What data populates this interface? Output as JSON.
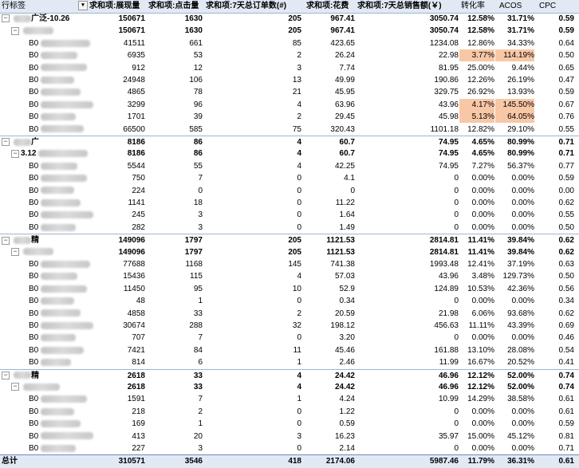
{
  "header": {
    "row_label": "行标签",
    "columns": [
      "求和项:展现量",
      "求和项:点击量",
      "求和项:7天总订单数(#)",
      "求和项:花费",
      "求和项:7天总销售额(￥)",
      "转化率",
      "ACOS",
      "CPC"
    ],
    "filter_icon": "filter-dropdown-icon",
    "expand_icon": "collapse-minus-icon"
  },
  "rows": [
    {
      "label": "广泛-10.26",
      "blurred": true,
      "level": 0,
      "expander": true,
      "bold": true,
      "values": [
        "150671",
        "1630",
        "205",
        "967.41",
        "3050.74",
        "12.58%",
        "31.71%",
        "0.59"
      ],
      "hl": []
    },
    {
      "label": "",
      "blurred": true,
      "level": 1,
      "expander": true,
      "bold": true,
      "values": [
        "150671",
        "1630",
        "205",
        "967.41",
        "3050.74",
        "12.58%",
        "31.71%",
        "0.59"
      ],
      "hl": []
    },
    {
      "label": "B0",
      "blurred": true,
      "level": 2,
      "bold": false,
      "values": [
        "41511",
        "661",
        "85",
        "423.65",
        "1234.08",
        "12.86%",
        "34.33%",
        "0.64"
      ],
      "hl": []
    },
    {
      "label": "B0",
      "blurred": true,
      "level": 2,
      "bold": false,
      "values": [
        "6935",
        "53",
        "2",
        "26.24",
        "22.98",
        "3.77%",
        "114.19%",
        "0.50"
      ],
      "hl": [
        5,
        6
      ]
    },
    {
      "label": "B0",
      "blurred": true,
      "level": 2,
      "bold": false,
      "values": [
        "912",
        "12",
        "3",
        "7.74",
        "81.95",
        "25.00%",
        "9.44%",
        "0.65"
      ],
      "hl": []
    },
    {
      "label": "B0",
      "blurred": true,
      "level": 2,
      "bold": false,
      "values": [
        "24948",
        "106",
        "13",
        "49.99",
        "190.86",
        "12.26%",
        "26.19%",
        "0.47"
      ],
      "hl": []
    },
    {
      "label": "B0",
      "blurred": true,
      "level": 2,
      "bold": false,
      "values": [
        "4865",
        "78",
        "21",
        "45.95",
        "329.75",
        "26.92%",
        "13.93%",
        "0.59"
      ],
      "hl": []
    },
    {
      "label": "B0",
      "blurred": true,
      "level": 2,
      "bold": false,
      "values": [
        "3299",
        "96",
        "4",
        "63.96",
        "43.96",
        "4.17%",
        "145.50%",
        "0.67"
      ],
      "hl": [
        5,
        6
      ]
    },
    {
      "label": "B0",
      "blurred": true,
      "level": 2,
      "bold": false,
      "values": [
        "1701",
        "39",
        "2",
        "29.45",
        "45.98",
        "5.13%",
        "64.05%",
        "0.76"
      ],
      "hl": [
        5,
        6
      ]
    },
    {
      "label": "B0",
      "blurred": true,
      "level": 2,
      "bold": false,
      "values": [
        "66500",
        "585",
        "75",
        "320.43",
        "1101.18",
        "12.82%",
        "29.10%",
        "0.55"
      ],
      "hl": []
    },
    {
      "label": "广",
      "blurred": true,
      "level": 0,
      "expander": true,
      "bold": true,
      "group": true,
      "values": [
        "8186",
        "86",
        "4",
        "60.7",
        "74.95",
        "4.65%",
        "80.99%",
        "0.71"
      ],
      "hl": []
    },
    {
      "label": "3.12",
      "blurred": true,
      "level": 1,
      "expander": true,
      "bold": true,
      "values": [
        "8186",
        "86",
        "4",
        "60.7",
        "74.95",
        "4.65%",
        "80.99%",
        "0.71"
      ],
      "hl": []
    },
    {
      "label": "B0",
      "blurred": true,
      "level": 2,
      "bold": false,
      "values": [
        "5544",
        "55",
        "4",
        "42.25",
        "74.95",
        "7.27%",
        "56.37%",
        "0.77"
      ],
      "hl": []
    },
    {
      "label": "B0",
      "blurred": true,
      "level": 2,
      "bold": false,
      "values": [
        "750",
        "7",
        "0",
        "4.1",
        "0",
        "0.00%",
        "0.00%",
        "0.59"
      ],
      "hl": []
    },
    {
      "label": "B0",
      "blurred": true,
      "level": 2,
      "bold": false,
      "values": [
        "224",
        "0",
        "0",
        "0",
        "0",
        "0.00%",
        "0.00%",
        "0.00"
      ],
      "hl": []
    },
    {
      "label": "B0",
      "blurred": true,
      "level": 2,
      "bold": false,
      "values": [
        "1141",
        "18",
        "0",
        "11.22",
        "0",
        "0.00%",
        "0.00%",
        "0.62"
      ],
      "hl": []
    },
    {
      "label": "B0",
      "blurred": true,
      "level": 2,
      "bold": false,
      "values": [
        "245",
        "3",
        "0",
        "1.64",
        "0",
        "0.00%",
        "0.00%",
        "0.55"
      ],
      "hl": []
    },
    {
      "label": "B0",
      "blurred": true,
      "level": 2,
      "bold": false,
      "values": [
        "282",
        "3",
        "0",
        "1.49",
        "0",
        "0.00%",
        "0.00%",
        "0.50"
      ],
      "hl": []
    },
    {
      "label": "精",
      "blurred": true,
      "level": 0,
      "expander": true,
      "bold": true,
      "group": true,
      "values": [
        "149096",
        "1797",
        "205",
        "1121.53",
        "2814.81",
        "11.41%",
        "39.84%",
        "0.62"
      ],
      "hl": []
    },
    {
      "label": "",
      "blurred": true,
      "level": 1,
      "expander": true,
      "bold": true,
      "values": [
        "149096",
        "1797",
        "205",
        "1121.53",
        "2814.81",
        "11.41%",
        "39.84%",
        "0.62"
      ],
      "hl": []
    },
    {
      "label": "B0",
      "blurred": true,
      "level": 2,
      "bold": false,
      "values": [
        "77688",
        "1168",
        "145",
        "741.38",
        "1993.48",
        "12.41%",
        "37.19%",
        "0.63"
      ],
      "hl": []
    },
    {
      "label": "B0",
      "blurred": true,
      "level": 2,
      "bold": false,
      "values": [
        "15436",
        "115",
        "4",
        "57.03",
        "43.96",
        "3.48%",
        "129.73%",
        "0.50"
      ],
      "hl": []
    },
    {
      "label": "B0",
      "blurred": true,
      "level": 2,
      "bold": false,
      "values": [
        "11450",
        "95",
        "10",
        "52.9",
        "124.89",
        "10.53%",
        "42.36%",
        "0.56"
      ],
      "hl": []
    },
    {
      "label": "B0",
      "blurred": true,
      "level": 2,
      "bold": false,
      "values": [
        "48",
        "1",
        "0",
        "0.34",
        "0",
        "0.00%",
        "0.00%",
        "0.34"
      ],
      "hl": []
    },
    {
      "label": "B0",
      "blurred": true,
      "level": 2,
      "bold": false,
      "values": [
        "4858",
        "33",
        "2",
        "20.59",
        "21.98",
        "6.06%",
        "93.68%",
        "0.62"
      ],
      "hl": []
    },
    {
      "label": "B0",
      "blurred": true,
      "level": 2,
      "bold": false,
      "values": [
        "30674",
        "288",
        "32",
        "198.12",
        "456.63",
        "11.11%",
        "43.39%",
        "0.69"
      ],
      "hl": []
    },
    {
      "label": "B0",
      "blurred": true,
      "level": 2,
      "bold": false,
      "values": [
        "707",
        "7",
        "0",
        "3.20",
        "0",
        "0.00%",
        "0.00%",
        "0.46"
      ],
      "hl": []
    },
    {
      "label": "B0",
      "blurred": true,
      "level": 2,
      "bold": false,
      "values": [
        "7421",
        "84",
        "11",
        "45.46",
        "161.88",
        "13.10%",
        "28.08%",
        "0.54"
      ],
      "hl": []
    },
    {
      "label": "B0",
      "blurred": true,
      "level": 2,
      "bold": false,
      "values": [
        "814",
        "6",
        "1",
        "2.46",
        "11.99",
        "16.67%",
        "20.52%",
        "0.41"
      ],
      "hl": []
    },
    {
      "label": "精",
      "blurred": true,
      "level": 0,
      "expander": true,
      "bold": true,
      "group": true,
      "values": [
        "2618",
        "33",
        "4",
        "24.42",
        "46.96",
        "12.12%",
        "52.00%",
        "0.74"
      ],
      "hl": []
    },
    {
      "label": "",
      "blurred": true,
      "level": 1,
      "expander": true,
      "bold": true,
      "values": [
        "2618",
        "33",
        "4",
        "24.42",
        "46.96",
        "12.12%",
        "52.00%",
        "0.74"
      ],
      "hl": []
    },
    {
      "label": "B0",
      "blurred": true,
      "level": 2,
      "bold": false,
      "values": [
        "1591",
        "7",
        "1",
        "4.24",
        "10.99",
        "14.29%",
        "38.58%",
        "0.61"
      ],
      "hl": []
    },
    {
      "label": "B0",
      "blurred": true,
      "level": 2,
      "bold": false,
      "values": [
        "218",
        "2",
        "0",
        "1.22",
        "0",
        "0.00%",
        "0.00%",
        "0.61"
      ],
      "hl": []
    },
    {
      "label": "B0",
      "blurred": true,
      "level": 2,
      "bold": false,
      "values": [
        "169",
        "1",
        "0",
        "0.59",
        "0",
        "0.00%",
        "0.00%",
        "0.59"
      ],
      "hl": []
    },
    {
      "label": "B0",
      "blurred": true,
      "level": 2,
      "bold": false,
      "values": [
        "413",
        "20",
        "3",
        "16.23",
        "35.97",
        "15.00%",
        "45.12%",
        "0.81"
      ],
      "hl": []
    },
    {
      "label": "B0",
      "blurred": true,
      "level": 2,
      "bold": false,
      "values": [
        "227",
        "3",
        "0",
        "2.14",
        "0",
        "0.00%",
        "0.00%",
        "0.71"
      ],
      "hl": []
    }
  ],
  "total": {
    "label": "总计",
    "values": [
      "310571",
      "3546",
      "418",
      "2174.06",
      "5987.46",
      "11.79%",
      "36.31%",
      "0.61"
    ]
  }
}
